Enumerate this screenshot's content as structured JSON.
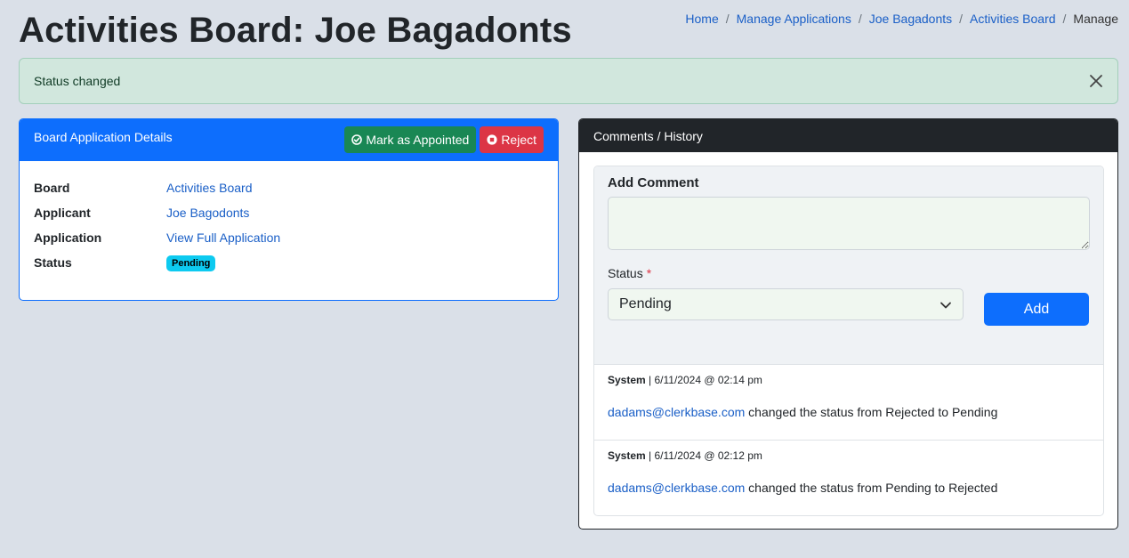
{
  "header": {
    "title": "Activities Board: Joe Bagadonts"
  },
  "breadcrumb": [
    "Home",
    "Manage Applications",
    "Joe Bagadonts",
    "Activities Board"
  ],
  "breadcrumb_current": "Manage",
  "alert": {
    "message": "Status changed",
    "close_icon": "close-icon"
  },
  "details_card": {
    "title": "Board Application Details",
    "appoint_label": "Mark as Appointed",
    "reject_label": "Reject",
    "rows": {
      "board_label": "Board",
      "board_value": "Activities Board",
      "applicant_label": "Applicant",
      "applicant_value": "Joe Bagodonts",
      "application_label": "Application",
      "application_value": "View Full Application",
      "status_label": "Status",
      "status_value": "Pending"
    },
    "colors": {
      "header": "#0d6efd",
      "appoint": "#198754",
      "reject": "#dc3545",
      "badge": "#0dcaf0"
    }
  },
  "comments_card": {
    "title": "Comments / History",
    "form_title": "Add Comment",
    "comment_value": "",
    "status_label": "Status",
    "required_mark": "*",
    "status_selected": "Pending",
    "add_label": "Add",
    "history": [
      {
        "author": "System",
        "timestamp": "6/11/2024 @ 02:14 pm",
        "user": "dadams@clerkbase.com",
        "text": "changed the status from Rejected to Pending"
      },
      {
        "author": "System",
        "timestamp": "6/11/2024 @ 02:12 pm",
        "user": "dadams@clerkbase.com",
        "text": "changed the status from Pending to Rejected"
      }
    ]
  }
}
